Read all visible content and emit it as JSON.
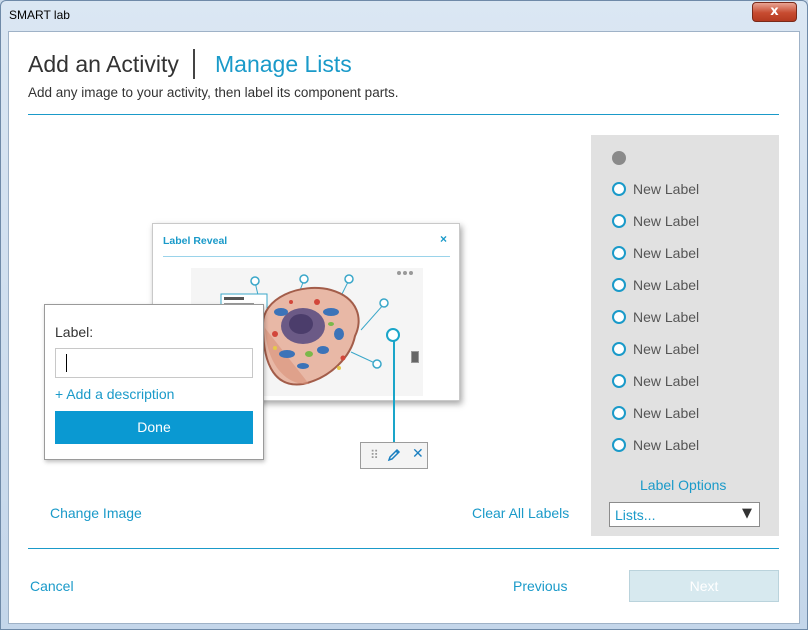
{
  "window": {
    "title": "SMART lab",
    "close_glyph": "x"
  },
  "header": {
    "title": "Add an Activity",
    "manage_lists": "Manage Lists",
    "subtitle": "Add any image to your activity, then label its component parts."
  },
  "preview": {
    "title": "Label Reveal",
    "close_glyph": "×"
  },
  "label_popup": {
    "label": "Label:",
    "input_value": "",
    "add_description": "+ Add a description",
    "done": "Done"
  },
  "marker_tools": {
    "grip_glyph": "⠿",
    "delete_glyph": "✕"
  },
  "links": {
    "change_image": "Change Image",
    "clear_all": "Clear All Labels"
  },
  "labels_panel": {
    "items": [
      "New Label",
      "New Label",
      "New Label",
      "New Label",
      "New Label",
      "New Label",
      "New Label",
      "New Label",
      "New Label"
    ],
    "label_options": "Label Options",
    "lists_value": "Lists...",
    "lists_arrow": "▼"
  },
  "footer": {
    "cancel": "Cancel",
    "previous": "Previous",
    "next": "Next"
  },
  "colors": {
    "accent": "#1a9ac9",
    "button": "#0a99d2",
    "panel": "#e1e1e1",
    "disabled": "#d7e9ef"
  },
  "icons": [
    "close-icon",
    "drag-grip-icon",
    "pencil-icon",
    "delete-icon",
    "dropdown-arrow-icon",
    "cell-diagram-image"
  ]
}
